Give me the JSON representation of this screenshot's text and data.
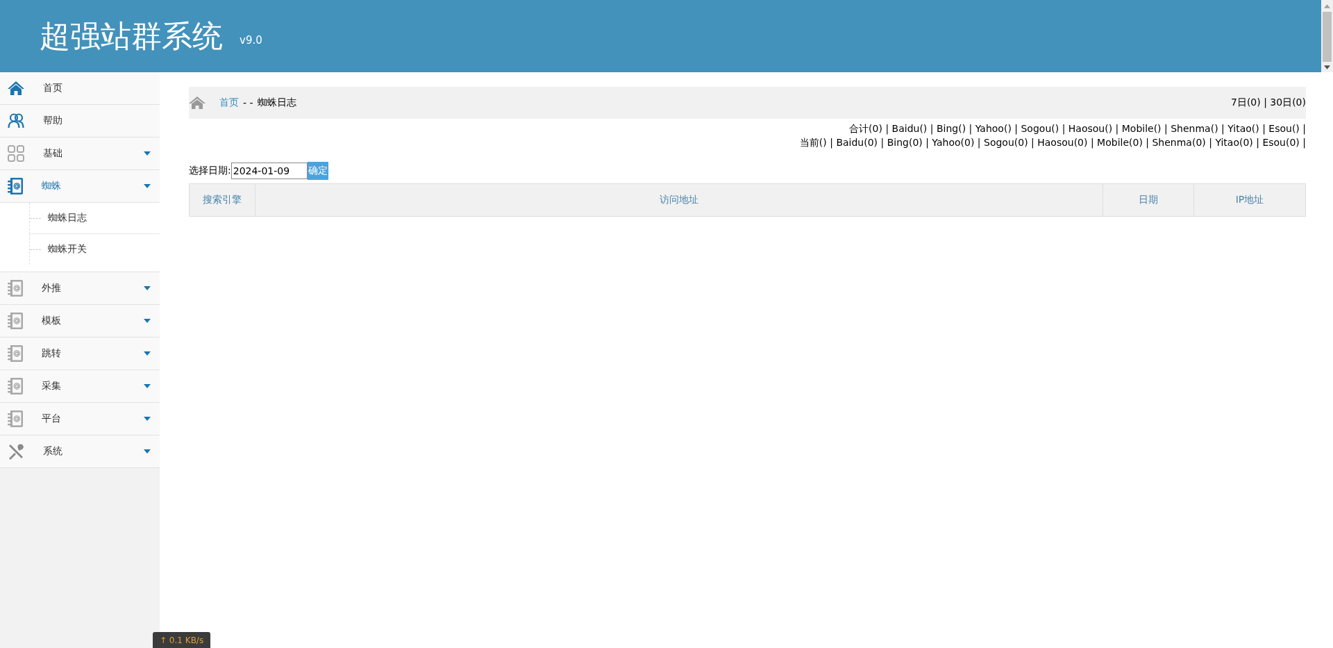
{
  "header": {
    "title": "超强站群系统",
    "version": "v9.0"
  },
  "sidebar": {
    "items": [
      {
        "label": "首页",
        "kind": "home",
        "selected": false,
        "has_arrow": false
      },
      {
        "label": "帮助",
        "kind": "users",
        "selected": false,
        "has_arrow": false
      },
      {
        "label": "基础",
        "kind": "grid",
        "selected": false,
        "has_arrow": true
      },
      {
        "label": "蜘蛛",
        "kind": "book",
        "selected": true,
        "has_arrow": true,
        "expanded": true,
        "children": [
          {
            "label": "蜘蛛日志"
          },
          {
            "label": "蜘蛛开关"
          }
        ]
      },
      {
        "label": "外推",
        "kind": "book",
        "selected": false,
        "has_arrow": true
      },
      {
        "label": "模板",
        "kind": "book",
        "selected": false,
        "has_arrow": true
      },
      {
        "label": "跳转",
        "kind": "book",
        "selected": false,
        "has_arrow": true
      },
      {
        "label": "采集",
        "kind": "book",
        "selected": false,
        "has_arrow": true
      },
      {
        "label": "平台",
        "kind": "book",
        "selected": false,
        "has_arrow": true
      },
      {
        "label": "系统",
        "kind": "tools",
        "selected": false,
        "has_arrow": true
      }
    ]
  },
  "breadcrumb": {
    "link": "首页",
    "separator": "- -",
    "current": "蜘蛛日志",
    "summary": "7日(0) | 30日(0)"
  },
  "stats": [
    "合计(0) | Baidu() | Bing() | Yahoo() | Sogou() | Haosou() | Mobile() | Shenma() | Yitao() | Esou() |",
    "当前() | Baidu(0) | Bing(0) | Yahoo(0) | Sogou(0) | Haosou(0) | Mobile(0) | Shenma(0) | Yitao(0) | Esou(0) |"
  ],
  "date_filter": {
    "label": "选择日期:",
    "value": "2024-01-09",
    "button": "确定"
  },
  "table": {
    "columns": [
      "搜索引擎",
      "访问地址",
      "日期",
      "IP地址"
    ]
  },
  "speed_overlay": "↑ 0.1 KB/s"
}
